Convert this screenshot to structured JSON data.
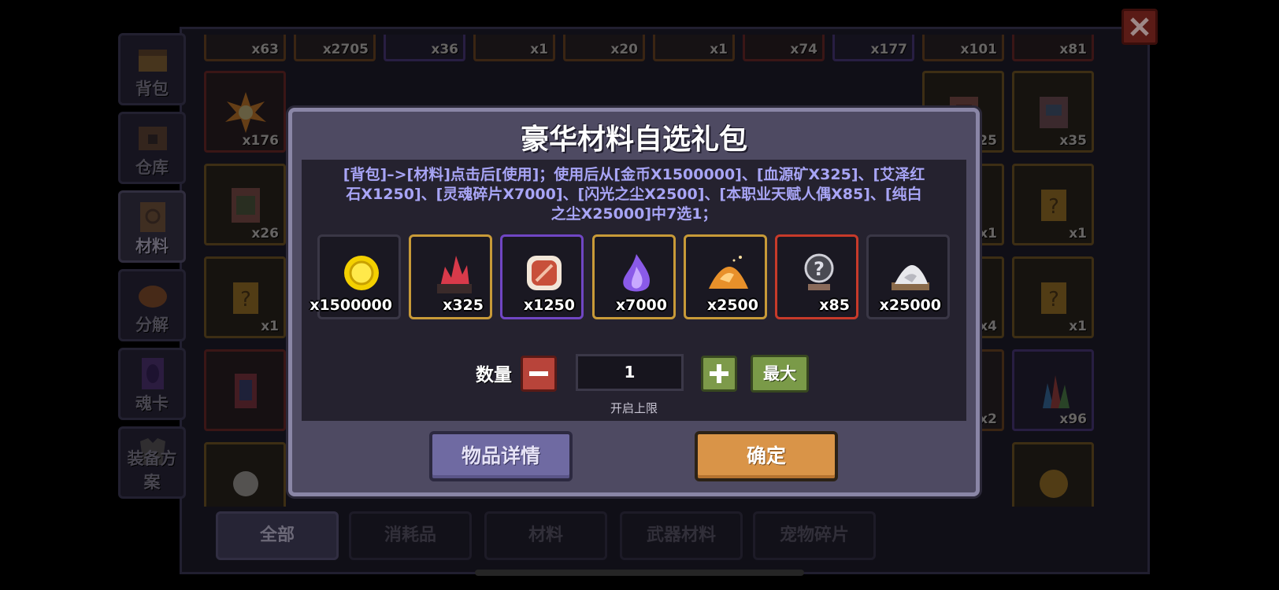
{
  "inventory": {
    "top_row_counts": [
      "x63",
      "x2705",
      "x36",
      "x1",
      "x20",
      "x1",
      "x74",
      "x177",
      "x101",
      "x81"
    ],
    "visible_counts": [
      "x176",
      "x25",
      "x35",
      "x26",
      "x1",
      "x1",
      "x1",
      "x4",
      "x1",
      "x2",
      "x96"
    ]
  },
  "side_tabs": [
    {
      "label": "背包"
    },
    {
      "label": "仓库"
    },
    {
      "label": "材料"
    },
    {
      "label": "分解"
    },
    {
      "label": "魂卡"
    },
    {
      "label": "装备方案"
    }
  ],
  "bottom_tabs": [
    {
      "label": "全部"
    },
    {
      "label": "消耗品"
    },
    {
      "label": "材料"
    },
    {
      "label": "武器材料"
    },
    {
      "label": "宠物碎片"
    }
  ],
  "dialog": {
    "title": "豪华材料自选礼包",
    "description": "[背包]–>[材料]点击后[使用]；使用后从[金币X1500000]、[血源矿X325]、[艾泽红石X1250]、[灵魂碎片X7000]、[闪光之尘X2500]、[本职业天赋人偶X85]、[纯白之尘X25000]中7选1；",
    "rewards": [
      {
        "icon": "gold-coin-icon",
        "count": "x1500000",
        "rarity": "none"
      },
      {
        "icon": "blood-ore-icon",
        "count": "x325",
        "rarity": "gold"
      },
      {
        "icon": "red-stone-icon",
        "count": "x1250",
        "rarity": "purple"
      },
      {
        "icon": "soul-fragment-icon",
        "count": "x7000",
        "rarity": "gold"
      },
      {
        "icon": "flash-dust-icon",
        "count": "x2500",
        "rarity": "gold"
      },
      {
        "icon": "talent-doll-icon",
        "count": "x85",
        "rarity": "red"
      },
      {
        "icon": "white-dust-icon",
        "count": "x25000",
        "rarity": "none"
      }
    ],
    "quantity_label": "数量",
    "quantity_value": "1",
    "max_label": "最大",
    "limit_label": "开启上限",
    "detail_button": "物品详情",
    "confirm_button": "确定"
  },
  "colors": {
    "rarity_gold": "#c89a38",
    "rarity_purple": "#7046c4",
    "rarity_red": "#c73a2a",
    "description_text": "#a8a5f6",
    "confirm": "#d99448",
    "detail": "#6f6aa2"
  }
}
